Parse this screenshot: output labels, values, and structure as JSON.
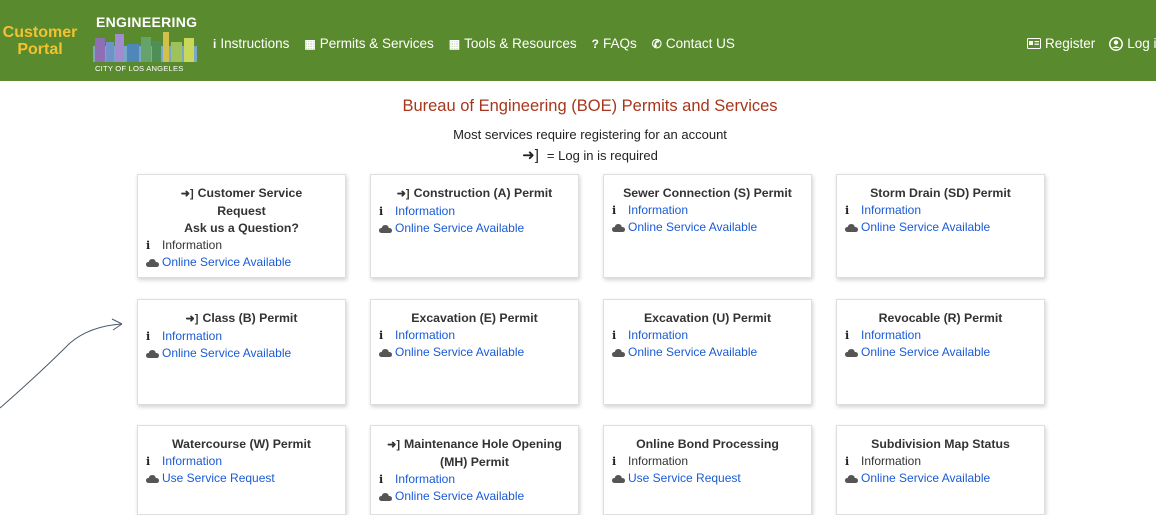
{
  "header": {
    "brand": "Customer Portal",
    "logo_title": "ENGINEERING",
    "logo_sub": "CITY OF LOS ANGELES",
    "nav": [
      {
        "icon": "i",
        "label": "Instructions"
      },
      {
        "icon": "▦",
        "label": "Permits & Services"
      },
      {
        "icon": "▦",
        "label": "Tools & Resources"
      },
      {
        "icon": "?",
        "label": "FAQs"
      },
      {
        "icon": "✆",
        "label": "Contact US"
      }
    ],
    "register_label": "Register",
    "login_label": "Log in"
  },
  "main": {
    "title": "Bureau of Engineering (BOE) Permits and Services",
    "subtitle": "Most services require registering for an account",
    "login_note": "= Log in is required"
  },
  "cards": [
    {
      "title_lines": [
        "Customer Service",
        "Request",
        "Ask us a Question?"
      ],
      "login": true,
      "info": "Information",
      "info_link": false,
      "service": "Online Service Available"
    },
    {
      "title_lines": [
        "Construction (A) Permit"
      ],
      "login": true,
      "info": "Information",
      "info_link": true,
      "service": "Online Service Available"
    },
    {
      "title_lines": [
        "Sewer Connection (S) Permit"
      ],
      "login": false,
      "info": "Information",
      "info_link": true,
      "service": "Online Service Available"
    },
    {
      "title_lines": [
        "Storm Drain (SD) Permit"
      ],
      "login": false,
      "info": "Information",
      "info_link": true,
      "service": "Online Service Available"
    },
    {
      "title_lines": [
        "Class (B) Permit"
      ],
      "login": true,
      "info": "Information",
      "info_link": true,
      "service": "Online Service Available"
    },
    {
      "title_lines": [
        "Excavation (E) Permit"
      ],
      "login": false,
      "info": "Information",
      "info_link": true,
      "service": "Online Service Available"
    },
    {
      "title_lines": [
        "Excavation (U) Permit"
      ],
      "login": false,
      "info": "Information",
      "info_link": true,
      "service": "Online Service Available"
    },
    {
      "title_lines": [
        "Revocable (R) Permit"
      ],
      "login": false,
      "info": "Information",
      "info_link": true,
      "service": "Online Service Available"
    },
    {
      "title_lines": [
        "Watercourse (W) Permit"
      ],
      "login": false,
      "info": "Information",
      "info_link": true,
      "service": "Use Service Request"
    },
    {
      "title_lines": [
        "Maintenance Hole Opening",
        "(MH) Permit"
      ],
      "login": true,
      "info": "Information",
      "info_link": true,
      "service": "Online Service Available"
    },
    {
      "title_lines": [
        "Online Bond Processing"
      ],
      "login": false,
      "info": "Information",
      "info_link": false,
      "service": "Use Service Request"
    },
    {
      "title_lines": [
        "Subdivision Map Status"
      ],
      "login": false,
      "info": "Information",
      "info_link": false,
      "service": "Online Service Available"
    }
  ],
  "colors": {
    "header_bg": "#5a8a2e",
    "brand": "#f2c230",
    "title": "#a7361c",
    "link": "#1a5bd6"
  }
}
